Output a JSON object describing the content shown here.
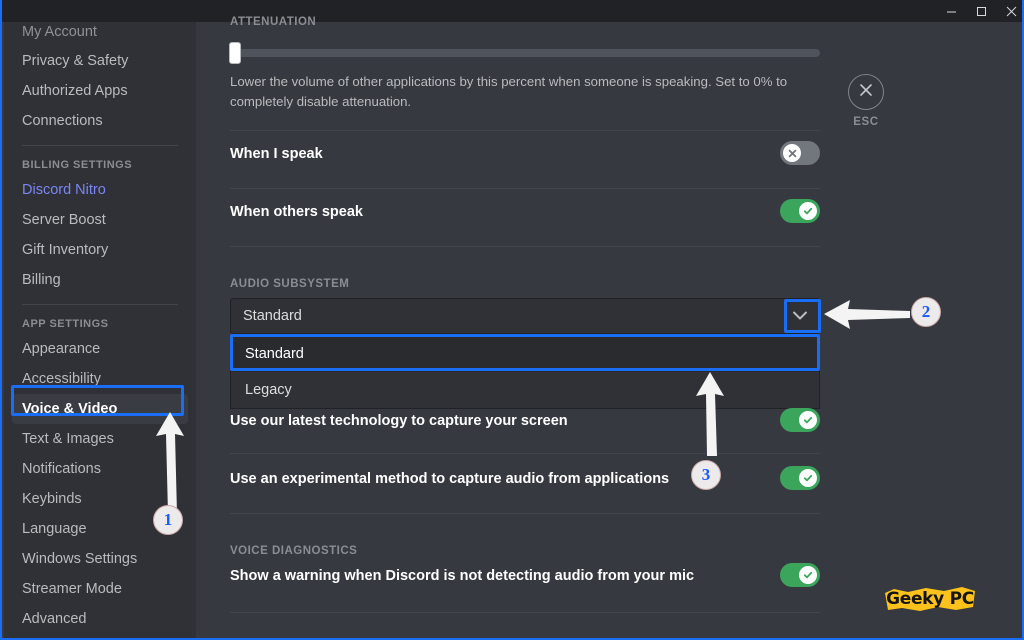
{
  "window": {
    "controls": [
      {
        "name": "minimize",
        "glyph": "minimize-icon"
      },
      {
        "name": "maximize",
        "glyph": "maximize-icon"
      },
      {
        "name": "close",
        "glyph": "close-icon"
      }
    ]
  },
  "sidebar": {
    "items": [
      {
        "label": "My Account",
        "type": "item",
        "state": "clipped"
      },
      {
        "label": "Privacy & Safety",
        "type": "item"
      },
      {
        "label": "Authorized Apps",
        "type": "item"
      },
      {
        "label": "Connections",
        "type": "item"
      }
    ],
    "billing_header": "BILLING SETTINGS",
    "billing_items": [
      {
        "label": "Discord Nitro",
        "type": "nitro"
      },
      {
        "label": "Server Boost",
        "type": "item"
      },
      {
        "label": "Gift Inventory",
        "type": "item"
      },
      {
        "label": "Billing",
        "type": "item"
      }
    ],
    "app_header": "APP SETTINGS",
    "app_items": [
      {
        "label": "Appearance",
        "type": "item"
      },
      {
        "label": "Accessibility",
        "type": "item"
      },
      {
        "label": "Voice & Video",
        "type": "active"
      },
      {
        "label": "Text & Images",
        "type": "item"
      },
      {
        "label": "Notifications",
        "type": "item"
      },
      {
        "label": "Keybinds",
        "type": "item"
      },
      {
        "label": "Language",
        "type": "item"
      },
      {
        "label": "Windows Settings",
        "type": "item"
      },
      {
        "label": "Streamer Mode",
        "type": "item"
      },
      {
        "label": "Advanced",
        "type": "item"
      }
    ]
  },
  "main": {
    "attenuation": {
      "header": "ATTENUATION",
      "slider_value": "0",
      "description": "Lower the volume of other applications by this percent when someone is speaking. Set to 0% to completely disable attenuation."
    },
    "rows": [
      {
        "label": "When I speak",
        "toggle": "off"
      },
      {
        "label": "When others speak",
        "toggle": "on"
      }
    ],
    "audio_subsystem": {
      "header": "AUDIO SUBSYSTEM",
      "selected": "Standard",
      "options": [
        {
          "label": "Standard",
          "selected": true
        },
        {
          "label": "Legacy",
          "selected": false
        }
      ],
      "caret": "chevron-down-icon"
    },
    "capture_rows": [
      {
        "label": "Use our latest technology to capture your screen",
        "toggle": "on"
      },
      {
        "label": "Use an experimental method to capture audio from applications",
        "toggle": "on"
      }
    ],
    "diagnostics": {
      "header": "VOICE DIAGNOSTICS",
      "row": {
        "label": "Show a warning when Discord is not detecting audio from your mic",
        "toggle": "on"
      }
    }
  },
  "esc": {
    "icon": "close-icon",
    "label": "ESC"
  },
  "annotations": {
    "callouts": [
      {
        "number": "1",
        "target": "Voice & Video"
      },
      {
        "number": "2",
        "target": "Audio subsystem dropdown caret"
      },
      {
        "number": "3",
        "target": "Standard option"
      }
    ],
    "highlight_color": "#1a6ef5"
  },
  "watermark": {
    "text": "Geeky PC",
    "color": "#fcc21b"
  }
}
